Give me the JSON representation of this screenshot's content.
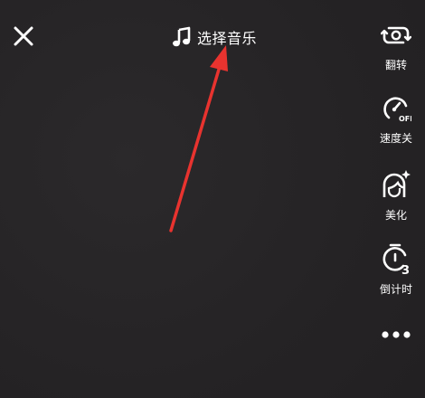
{
  "top_bar": {
    "close_icon": "close-icon",
    "music": {
      "icon": "music-note-icon",
      "label": "选择音乐"
    }
  },
  "side_toolbar": {
    "items": [
      {
        "icon": "flip-camera-icon",
        "label": "翻转"
      },
      {
        "icon": "speed-off-icon",
        "label": "速度关"
      },
      {
        "icon": "beautify-icon",
        "label": "美化"
      },
      {
        "icon": "timer-3-icon",
        "label": "倒计时"
      }
    ],
    "more_icon": "more-icon"
  },
  "annotation": {
    "arrow_color": "#e8332f"
  }
}
